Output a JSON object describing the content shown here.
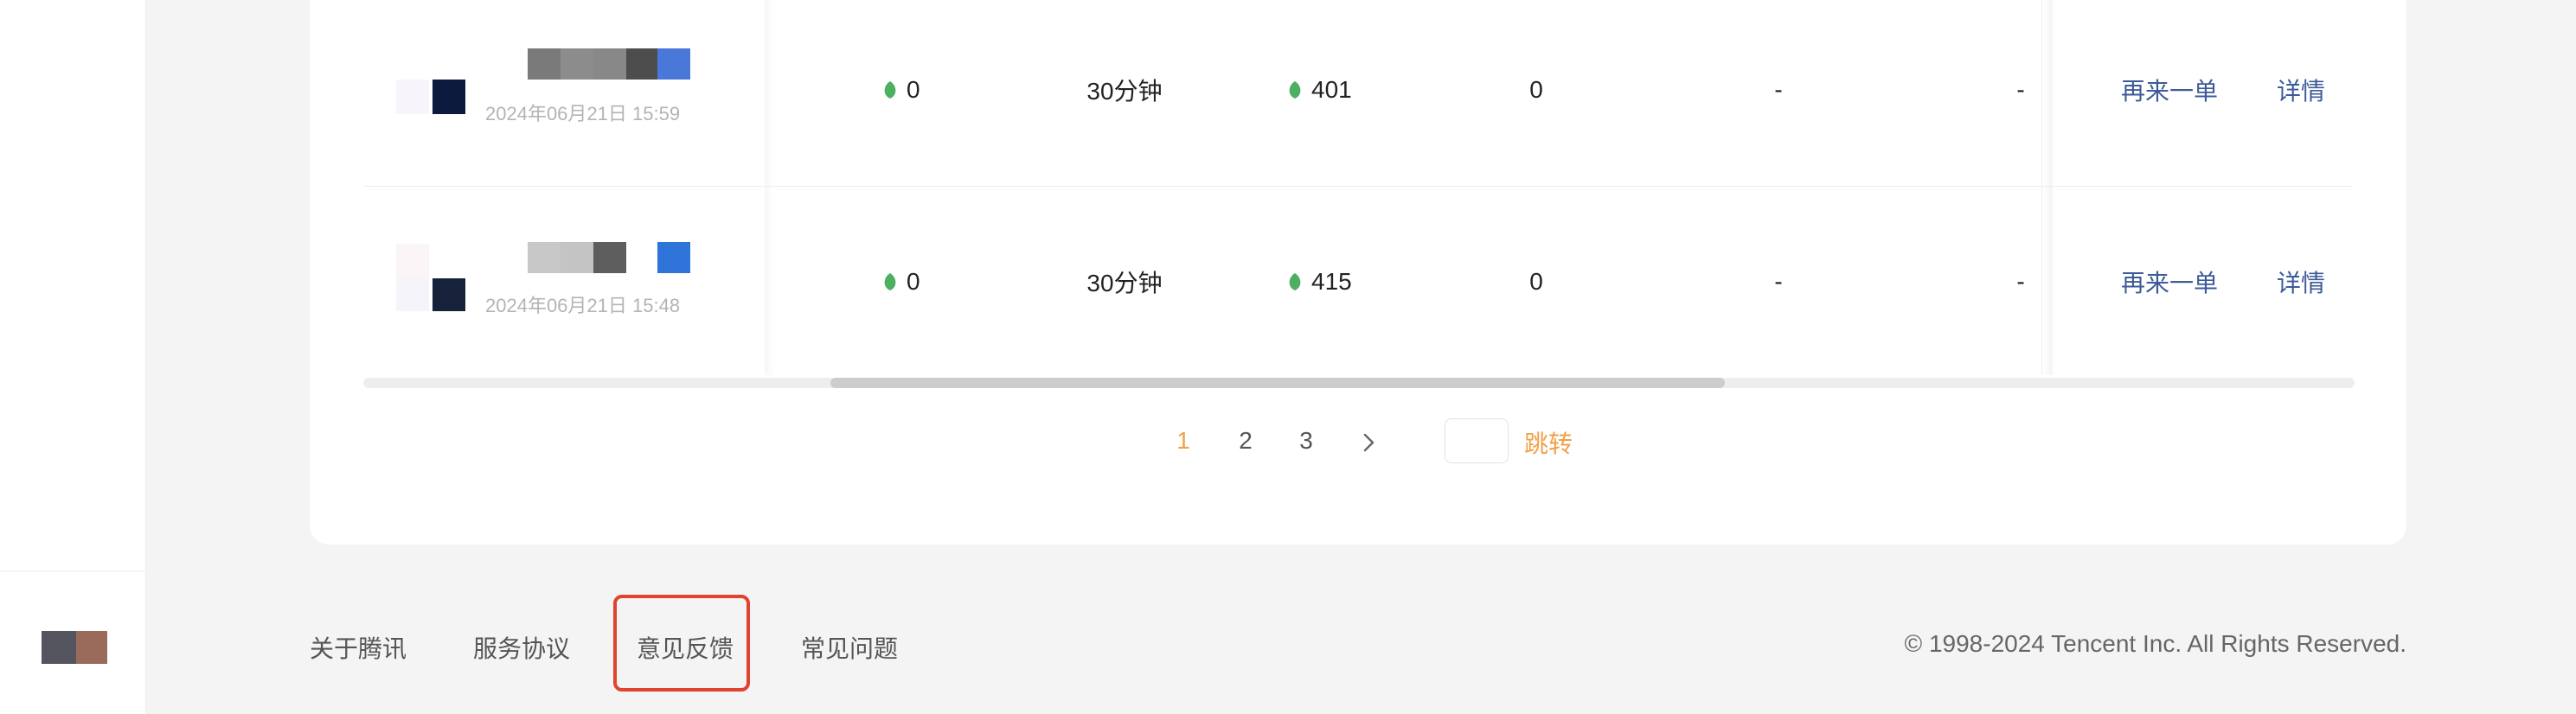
{
  "orders": [
    {
      "date": "2024年06月21日 15:59",
      "col1": "0",
      "duration": "30分钟",
      "col3": "401",
      "col4": "0",
      "col5": "-",
      "col6": "-",
      "reorder_label": "再来一单",
      "detail_label": "详情"
    },
    {
      "date": "2024年06月21日 15:48",
      "col1": "0",
      "duration": "30分钟",
      "col3": "415",
      "col4": "0",
      "col5": "-",
      "col6": "-",
      "reorder_label": "再来一单",
      "detail_label": "详情"
    }
  ],
  "pagination": {
    "pages": [
      "1",
      "2",
      "3"
    ],
    "current": "1",
    "jump_label": "跳转",
    "jump_value": ""
  },
  "footer": {
    "links": [
      "关于腾讯",
      "服务协议",
      "意见反馈",
      "常见问题"
    ],
    "highlighted_link": "意见反馈",
    "copyright": "© 1998-2024 Tencent Inc. All Rights Reserved."
  },
  "icons": {
    "value_icon": "green-leaf-icon",
    "next_page": "chevron-right-icon"
  },
  "colors": {
    "accent": "#f0a14a",
    "link": "#3d5b99",
    "leaf": "#4caf62",
    "highlight_box": "#e0432e"
  }
}
